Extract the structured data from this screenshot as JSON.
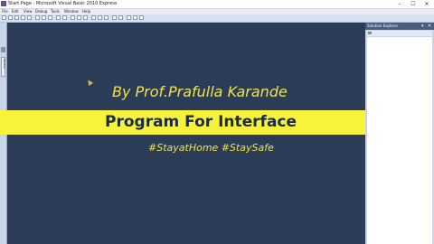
{
  "window": {
    "title": "Start Page - Microsoft Visual Basic 2010 Express",
    "minimize_glyph": "–",
    "maximize_glyph": "☐",
    "close_glyph": "✕"
  },
  "menu": {
    "items": [
      "File",
      "Edit",
      "View",
      "Debug",
      "Tools",
      "Window",
      "Help"
    ]
  },
  "toolbox": {
    "label": "Toolbox"
  },
  "overlay": {
    "byline": "By Prof.Prafulla Karande",
    "banner": "Program For Interface",
    "hashtags": "#StayatHome #StaySafe"
  },
  "solution_explorer": {
    "title": "Solution Explorer",
    "pin_glyph": "▾",
    "close_glyph": "✕"
  },
  "colors": {
    "background": "#2b3c59",
    "banner": "#f7f23a",
    "accent_text": "#f2e24a",
    "banner_text": "#1c2a44"
  }
}
